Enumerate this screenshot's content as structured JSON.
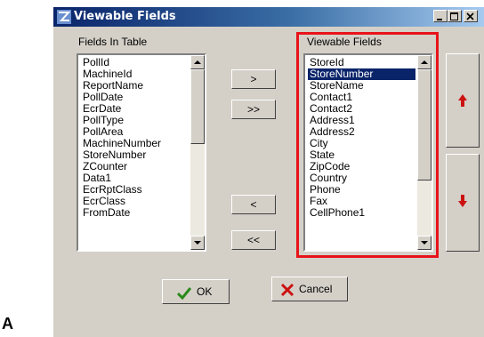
{
  "window": {
    "title": "Viewable Fields"
  },
  "left_list": {
    "label": "Fields In Table",
    "items": [
      "PollId",
      "MachineId",
      "ReportName",
      "PollDate",
      "EcrDate",
      "PollType",
      "PollArea",
      "MachineNumber",
      "StoreNumber",
      "ZCounter",
      "Data1",
      "EcrRptClass",
      "EcrClass",
      "FromDate"
    ]
  },
  "right_list": {
    "label": "Viewable Fields",
    "selected": "StoreNumber",
    "items": [
      "StoreId",
      "StoreNumber",
      "StoreName",
      "Contact1",
      "Contact2",
      "Address1",
      "Address2",
      "City",
      "State",
      "ZipCode",
      "Country",
      "Phone",
      "Fax",
      "CellPhone1"
    ]
  },
  "transfer": {
    "add": ">",
    "add_all": ">>",
    "remove": "<",
    "remove_all": "<<"
  },
  "ok_label": "OK",
  "cancel_label": "Cancel",
  "caption": "A",
  "colors": {
    "highlight": "#e8131a",
    "title_start": "#0a246a",
    "title_end": "#a6caf0",
    "selection": "#0a246a"
  },
  "icons": [
    "app-icon",
    "minimize-icon",
    "maximize-icon",
    "close-icon",
    "move-up-icon",
    "move-down-icon",
    "ok-check-icon",
    "cancel-x-icon"
  ]
}
